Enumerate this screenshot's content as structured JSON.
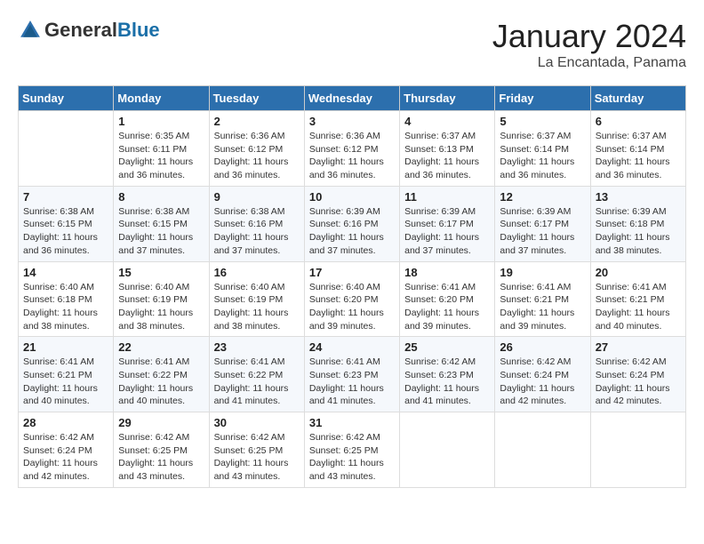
{
  "header": {
    "logo_general": "General",
    "logo_blue": "Blue",
    "month": "January 2024",
    "location": "La Encantada, Panama"
  },
  "weekdays": [
    "Sunday",
    "Monday",
    "Tuesday",
    "Wednesday",
    "Thursday",
    "Friday",
    "Saturday"
  ],
  "weeks": [
    [
      {
        "day": "",
        "sunrise": "",
        "sunset": "",
        "daylight": ""
      },
      {
        "day": "1",
        "sunrise": "Sunrise: 6:35 AM",
        "sunset": "Sunset: 6:11 PM",
        "daylight": "Daylight: 11 hours and 36 minutes."
      },
      {
        "day": "2",
        "sunrise": "Sunrise: 6:36 AM",
        "sunset": "Sunset: 6:12 PM",
        "daylight": "Daylight: 11 hours and 36 minutes."
      },
      {
        "day": "3",
        "sunrise": "Sunrise: 6:36 AM",
        "sunset": "Sunset: 6:12 PM",
        "daylight": "Daylight: 11 hours and 36 minutes."
      },
      {
        "day": "4",
        "sunrise": "Sunrise: 6:37 AM",
        "sunset": "Sunset: 6:13 PM",
        "daylight": "Daylight: 11 hours and 36 minutes."
      },
      {
        "day": "5",
        "sunrise": "Sunrise: 6:37 AM",
        "sunset": "Sunset: 6:14 PM",
        "daylight": "Daylight: 11 hours and 36 minutes."
      },
      {
        "day": "6",
        "sunrise": "Sunrise: 6:37 AM",
        "sunset": "Sunset: 6:14 PM",
        "daylight": "Daylight: 11 hours and 36 minutes."
      }
    ],
    [
      {
        "day": "7",
        "sunrise": "Sunrise: 6:38 AM",
        "sunset": "Sunset: 6:15 PM",
        "daylight": "Daylight: 11 hours and 36 minutes."
      },
      {
        "day": "8",
        "sunrise": "Sunrise: 6:38 AM",
        "sunset": "Sunset: 6:15 PM",
        "daylight": "Daylight: 11 hours and 37 minutes."
      },
      {
        "day": "9",
        "sunrise": "Sunrise: 6:38 AM",
        "sunset": "Sunset: 6:16 PM",
        "daylight": "Daylight: 11 hours and 37 minutes."
      },
      {
        "day": "10",
        "sunrise": "Sunrise: 6:39 AM",
        "sunset": "Sunset: 6:16 PM",
        "daylight": "Daylight: 11 hours and 37 minutes."
      },
      {
        "day": "11",
        "sunrise": "Sunrise: 6:39 AM",
        "sunset": "Sunset: 6:17 PM",
        "daylight": "Daylight: 11 hours and 37 minutes."
      },
      {
        "day": "12",
        "sunrise": "Sunrise: 6:39 AM",
        "sunset": "Sunset: 6:17 PM",
        "daylight": "Daylight: 11 hours and 37 minutes."
      },
      {
        "day": "13",
        "sunrise": "Sunrise: 6:39 AM",
        "sunset": "Sunset: 6:18 PM",
        "daylight": "Daylight: 11 hours and 38 minutes."
      }
    ],
    [
      {
        "day": "14",
        "sunrise": "Sunrise: 6:40 AM",
        "sunset": "Sunset: 6:18 PM",
        "daylight": "Daylight: 11 hours and 38 minutes."
      },
      {
        "day": "15",
        "sunrise": "Sunrise: 6:40 AM",
        "sunset": "Sunset: 6:19 PM",
        "daylight": "Daylight: 11 hours and 38 minutes."
      },
      {
        "day": "16",
        "sunrise": "Sunrise: 6:40 AM",
        "sunset": "Sunset: 6:19 PM",
        "daylight": "Daylight: 11 hours and 38 minutes."
      },
      {
        "day": "17",
        "sunrise": "Sunrise: 6:40 AM",
        "sunset": "Sunset: 6:20 PM",
        "daylight": "Daylight: 11 hours and 39 minutes."
      },
      {
        "day": "18",
        "sunrise": "Sunrise: 6:41 AM",
        "sunset": "Sunset: 6:20 PM",
        "daylight": "Daylight: 11 hours and 39 minutes."
      },
      {
        "day": "19",
        "sunrise": "Sunrise: 6:41 AM",
        "sunset": "Sunset: 6:21 PM",
        "daylight": "Daylight: 11 hours and 39 minutes."
      },
      {
        "day": "20",
        "sunrise": "Sunrise: 6:41 AM",
        "sunset": "Sunset: 6:21 PM",
        "daylight": "Daylight: 11 hours and 40 minutes."
      }
    ],
    [
      {
        "day": "21",
        "sunrise": "Sunrise: 6:41 AM",
        "sunset": "Sunset: 6:21 PM",
        "daylight": "Daylight: 11 hours and 40 minutes."
      },
      {
        "day": "22",
        "sunrise": "Sunrise: 6:41 AM",
        "sunset": "Sunset: 6:22 PM",
        "daylight": "Daylight: 11 hours and 40 minutes."
      },
      {
        "day": "23",
        "sunrise": "Sunrise: 6:41 AM",
        "sunset": "Sunset: 6:22 PM",
        "daylight": "Daylight: 11 hours and 41 minutes."
      },
      {
        "day": "24",
        "sunrise": "Sunrise: 6:41 AM",
        "sunset": "Sunset: 6:23 PM",
        "daylight": "Daylight: 11 hours and 41 minutes."
      },
      {
        "day": "25",
        "sunrise": "Sunrise: 6:42 AM",
        "sunset": "Sunset: 6:23 PM",
        "daylight": "Daylight: 11 hours and 41 minutes."
      },
      {
        "day": "26",
        "sunrise": "Sunrise: 6:42 AM",
        "sunset": "Sunset: 6:24 PM",
        "daylight": "Daylight: 11 hours and 42 minutes."
      },
      {
        "day": "27",
        "sunrise": "Sunrise: 6:42 AM",
        "sunset": "Sunset: 6:24 PM",
        "daylight": "Daylight: 11 hours and 42 minutes."
      }
    ],
    [
      {
        "day": "28",
        "sunrise": "Sunrise: 6:42 AM",
        "sunset": "Sunset: 6:24 PM",
        "daylight": "Daylight: 11 hours and 42 minutes."
      },
      {
        "day": "29",
        "sunrise": "Sunrise: 6:42 AM",
        "sunset": "Sunset: 6:25 PM",
        "daylight": "Daylight: 11 hours and 43 minutes."
      },
      {
        "day": "30",
        "sunrise": "Sunrise: 6:42 AM",
        "sunset": "Sunset: 6:25 PM",
        "daylight": "Daylight: 11 hours and 43 minutes."
      },
      {
        "day": "31",
        "sunrise": "Sunrise: 6:42 AM",
        "sunset": "Sunset: 6:25 PM",
        "daylight": "Daylight: 11 hours and 43 minutes."
      },
      {
        "day": "",
        "sunrise": "",
        "sunset": "",
        "daylight": ""
      },
      {
        "day": "",
        "sunrise": "",
        "sunset": "",
        "daylight": ""
      },
      {
        "day": "",
        "sunrise": "",
        "sunset": "",
        "daylight": ""
      }
    ]
  ]
}
